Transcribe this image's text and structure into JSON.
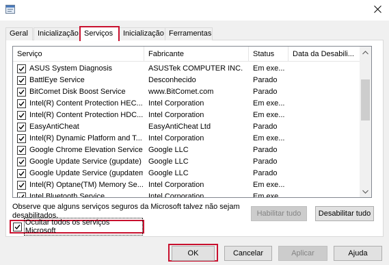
{
  "tabs": [
    "Geral",
    "Inicialização",
    "Serviços",
    "Inicialização",
    "Ferramentas"
  ],
  "columns": {
    "service": "Serviço",
    "manufacturer": "Fabricante",
    "status": "Status",
    "disabled_date": "Data da Desabili..."
  },
  "services": [
    {
      "name": "ASUS System Diagnosis",
      "manufacturer": "ASUSTek COMPUTER INC.",
      "status": "Em exe..."
    },
    {
      "name": "BattlEye Service",
      "manufacturer": "Desconhecido",
      "status": "Parado"
    },
    {
      "name": "BitComet Disk Boost Service",
      "manufacturer": "www.BitComet.com",
      "status": "Parado"
    },
    {
      "name": "Intel(R) Content Protection HEC...",
      "manufacturer": "Intel Corporation",
      "status": "Em exe..."
    },
    {
      "name": "Intel(R) Content Protection HDC...",
      "manufacturer": "Intel Corporation",
      "status": "Em exe..."
    },
    {
      "name": "EasyAntiCheat",
      "manufacturer": "EasyAntiCheat Ltd",
      "status": "Parado"
    },
    {
      "name": "Intel(R) Dynamic Platform and T...",
      "manufacturer": "Intel Corporation",
      "status": "Em exe..."
    },
    {
      "name": "Google Chrome Elevation Service",
      "manufacturer": "Google LLC",
      "status": "Parado"
    },
    {
      "name": "Google Update Service (gupdate)",
      "manufacturer": "Google LLC",
      "status": "Parado"
    },
    {
      "name": "Google Update Service (gupdatem)",
      "manufacturer": "Google LLC",
      "status": "Parado"
    },
    {
      "name": "Intel(R) Optane(TM) Memory Se...",
      "manufacturer": "Intel Corporation",
      "status": "Em exe..."
    },
    {
      "name": "Intel Bluetooth Service",
      "manufacturer": "Intel Corporation",
      "status": "Em exe..."
    }
  ],
  "note": "Observe que alguns serviços seguros da Microsoft talvez não sejam desabilitados.",
  "buttons": {
    "enable_all": "Habilitar tudo",
    "disable_all": "Desabilitar tudo",
    "ok": "OK",
    "cancel": "Cancelar",
    "apply": "Aplicar",
    "help": "Ajuda"
  },
  "hide_ms_label": "Ocultar todos os serviços Microsoft",
  "colors": {
    "highlight": "#c8102e"
  }
}
